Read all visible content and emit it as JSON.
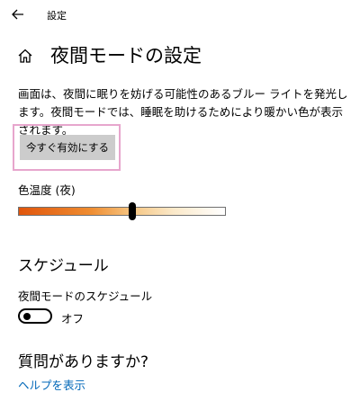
{
  "window": {
    "title": "設定"
  },
  "page": {
    "title": "夜間モードの設定"
  },
  "description": "画面は、夜間に眠りを妨げる可能性のあるブルー ライトを発光します。夜間モードでは、睡眠を助けるためにより暖かい色が表示されます。",
  "enable_button": {
    "label": "今すぐ有効にする"
  },
  "color_temperature": {
    "label": "色温度 (夜)",
    "level": 0.55
  },
  "schedule": {
    "section_title": "スケジュール",
    "toggle_label": "夜間モードのスケジュール",
    "toggle_state": "オフ",
    "is_on": false
  },
  "help": {
    "title": "質問がありますか?",
    "link": "ヘルプを表示"
  },
  "colors": {
    "accent_link": "#0067b8",
    "highlight_border": "#e7a6cd"
  },
  "icons": {
    "back": "back-arrow-icon",
    "home": "home-icon"
  }
}
